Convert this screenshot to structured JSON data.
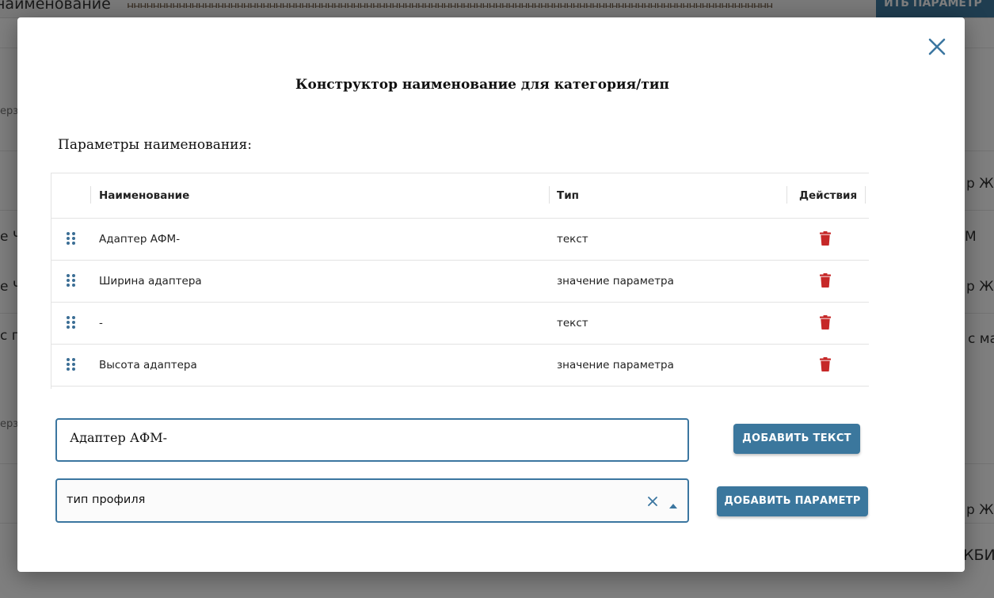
{
  "background": {
    "title": "наименование",
    "hatch": "нннннннннннннннннннннннннннннннннннннннннннннннннннннннннннннннннннннннннннннннннннннннннннннннннннн",
    "top_button": "ИТЬ ПАРАМЕТР",
    "left_fragments": [
      "ерз",
      "",
      "е Ч",
      "е Ч",
      "с п",
      "ерз"
    ],
    "right_fragments": [
      "р Ж",
      "М",
      "р Ж",
      "с ма",
      "р Ж",
      "КБИ"
    ]
  },
  "modal": {
    "title": "Конструктор наименование для категория/тип",
    "close_icon": "close-icon",
    "section_label": "Параметры наименования:",
    "table": {
      "columns": [
        "Наименование",
        "Тип",
        "Действия"
      ],
      "rows": [
        {
          "name": "Адаптер АФМ-",
          "type": "текст"
        },
        {
          "name": "Ширина адаптера",
          "type": "значение параметра"
        },
        {
          "name": "-",
          "type": "текст"
        },
        {
          "name": "Высота адаптера",
          "type": "значение параметра"
        }
      ]
    },
    "text_input": {
      "value": "Адаптер АФМ-"
    },
    "add_text_button": "ДОБАВИТЬ ТЕКСТ",
    "param_select": {
      "value": "тип профиля"
    },
    "add_param_button": "ДОБАВИТЬ ПАРАМЕТР"
  },
  "colors": {
    "accent": "#3b779d",
    "delete": "#c62828",
    "drag_handle": "#3b6e95"
  }
}
